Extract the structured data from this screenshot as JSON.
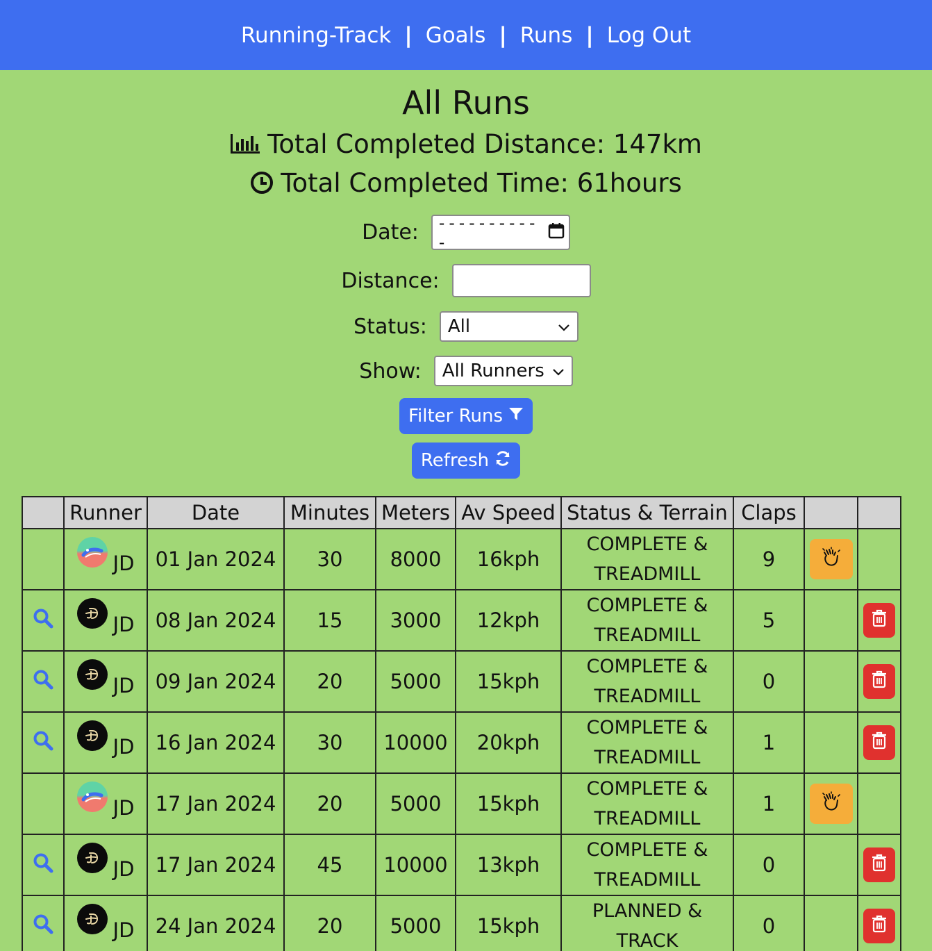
{
  "nav": {
    "brand": "Running-Track",
    "links": [
      "Goals",
      "Runs",
      "Log Out"
    ],
    "separator": "|"
  },
  "page": {
    "title": "All Runs",
    "total_distance": "Total Completed Distance: 147km",
    "total_time": "Total Completed Time: 61hours"
  },
  "filters": {
    "date_label": "Date:",
    "date_value": "---------- -",
    "distance_label": "Distance:",
    "distance_value": "",
    "status_label": "Status:",
    "status_value": "All",
    "show_label": "Show:",
    "show_value": "All Runners",
    "filter_button": "Filter Runs",
    "refresh_button": "Refresh"
  },
  "table": {
    "headers": [
      "",
      "Runner",
      "Date",
      "Minutes",
      "Meters",
      "Av Speed",
      "Status & Terrain",
      "Claps",
      "",
      ""
    ],
    "rows": [
      {
        "view": false,
        "avatar": "color",
        "runner": "JD",
        "date": "01 Jan 2024",
        "minutes": "30",
        "meters": "8000",
        "speed": "16kph",
        "status": "COMPLETE &",
        "terrain": "TREADMILL",
        "claps": "9",
        "clap_button": true,
        "delete": false
      },
      {
        "view": true,
        "avatar": "black",
        "runner": "JD",
        "date": "08 Jan 2024",
        "minutes": "15",
        "meters": "3000",
        "speed": "12kph",
        "status": "COMPLETE &",
        "terrain": "TREADMILL",
        "claps": "5",
        "clap_button": false,
        "delete": true
      },
      {
        "view": true,
        "avatar": "black",
        "runner": "JD",
        "date": "09 Jan 2024",
        "minutes": "20",
        "meters": "5000",
        "speed": "15kph",
        "status": "COMPLETE &",
        "terrain": "TREADMILL",
        "claps": "0",
        "clap_button": false,
        "delete": true
      },
      {
        "view": true,
        "avatar": "black",
        "runner": "JD",
        "date": "16 Jan 2024",
        "minutes": "30",
        "meters": "10000",
        "speed": "20kph",
        "status": "COMPLETE &",
        "terrain": "TREADMILL",
        "claps": "1",
        "clap_button": false,
        "delete": true
      },
      {
        "view": false,
        "avatar": "color",
        "runner": "JD",
        "date": "17 Jan 2024",
        "minutes": "20",
        "meters": "5000",
        "speed": "15kph",
        "status": "COMPLETE &",
        "terrain": "TREADMILL",
        "claps": "1",
        "clap_button": true,
        "delete": false
      },
      {
        "view": true,
        "avatar": "black",
        "runner": "JD",
        "date": "17 Jan 2024",
        "minutes": "45",
        "meters": "10000",
        "speed": "13kph",
        "status": "COMPLETE &",
        "terrain": "TREADMILL",
        "claps": "0",
        "clap_button": false,
        "delete": true
      },
      {
        "view": true,
        "avatar": "black",
        "runner": "JD",
        "date": "24 Jan 2024",
        "minutes": "20",
        "meters": "5000",
        "speed": "15kph",
        "status": "PLANNED &",
        "terrain": "TRACK",
        "claps": "0",
        "clap_button": false,
        "delete": true
      }
    ]
  },
  "colors": {
    "navbar": "#3e6ef0",
    "background": "#a1d776",
    "clap_button": "#f5ad3a",
    "delete_button": "#e0312e",
    "header_bg": "#d3d3d3"
  },
  "icons": {
    "stat_distance": "bar-chart-icon",
    "stat_time": "clock-icon",
    "filter": "filter-icon",
    "refresh": "refresh-icon",
    "view": "search-icon",
    "clap": "clap-icon",
    "delete": "trash-icon",
    "calendar": "calendar-icon",
    "chevron": "chevron-down-icon"
  }
}
